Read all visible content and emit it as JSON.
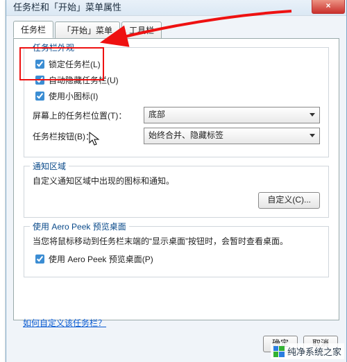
{
  "window": {
    "title": "任务栏和「开始」菜单属性",
    "close_glyph": "×"
  },
  "tabs": [
    "任务栏",
    "「开始」菜单",
    "工具栏"
  ],
  "appearance": {
    "legend": "任务栏外观",
    "lock": "锁定任务栏(L)",
    "autohide": "自动隐藏任务栏(U)",
    "small_icons": "使用小图标(I)",
    "position_label": "屏幕上的任务栏位置(T)：",
    "position_value": "底部",
    "buttons_label": "任务栏按钮(B)：",
    "buttons_value": "始终合并、隐藏标签"
  },
  "notification": {
    "legend": "通知区域",
    "desc": "自定义通知区域中出现的图标和通知。",
    "customize_btn": "自定义(C)..."
  },
  "aero": {
    "legend": "使用 Aero Peek 预览桌面",
    "desc": "当您将鼠标移动到任务栏末端的“显示桌面”按钮时，会暂时查看桌面。",
    "checkbox": "使用 Aero Peek 预览桌面(P)"
  },
  "help_link": "如何自定义该任务栏？",
  "buttons": {
    "ok": "确定",
    "cancel": "取消"
  },
  "watermark": "纯净系统之家"
}
